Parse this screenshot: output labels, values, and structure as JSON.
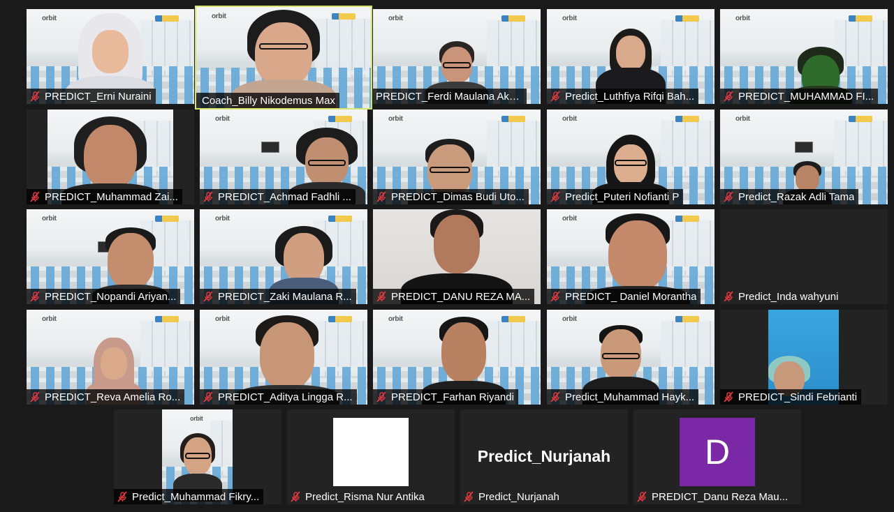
{
  "participants": [
    {
      "name": "PREDICT_Erni Nuraini"
    },
    {
      "name": "Coach_Billy Nikodemus Max"
    },
    {
      "name": "PREDICT_Ferdi Maulana Akb..."
    },
    {
      "name": "Predict_Luthfiya Rifqi Bah..."
    },
    {
      "name": "PREDICT_MUHAMMAD FI..."
    },
    {
      "name": "PREDICT_Muhammad Zai..."
    },
    {
      "name": "PREDICT_Achmad Fadhli ..."
    },
    {
      "name": "PREDICT_Dimas Budi Uto..."
    },
    {
      "name": "Predict_Puteri Nofianti P"
    },
    {
      "name": "Predict_Razak Adli Tama"
    },
    {
      "name": "PREDICT_Nopandi Ariyan..."
    },
    {
      "name": "PREDICT_Zaki Maulana R..."
    },
    {
      "name": "PREDICT_DANU REZA MA..."
    },
    {
      "name": "PREDICT_ Daniel Morantha"
    },
    {
      "name": "Predict_Inda wahyuni"
    },
    {
      "name": "PREDICT_Reva Amelia Ro..."
    },
    {
      "name": "PREDICT_Aditya Lingga R..."
    },
    {
      "name": "PREDICT_Farhan Riyandi"
    },
    {
      "name": "Predict_Muhammad Hayk..."
    },
    {
      "name": "PREDICT_Sindi Febrianti"
    },
    {
      "name": "Predict_Muhammad Fikry..."
    },
    {
      "name": "Predict_Risma Nur Antika"
    },
    {
      "name": "Predict_Nurjanah",
      "display": "Predict_Nurjanah"
    },
    {
      "name": "PREDICT_Danu Reza Mau...",
      "avatar_letter": "D"
    }
  ],
  "background_logo": "orbit",
  "icons": {
    "mic": "mic-muted-icon"
  },
  "colors": {
    "active_speaker_border": "#d7e36a",
    "mute_icon": "#e0393e",
    "avatar_purple": "#7a28a5"
  }
}
